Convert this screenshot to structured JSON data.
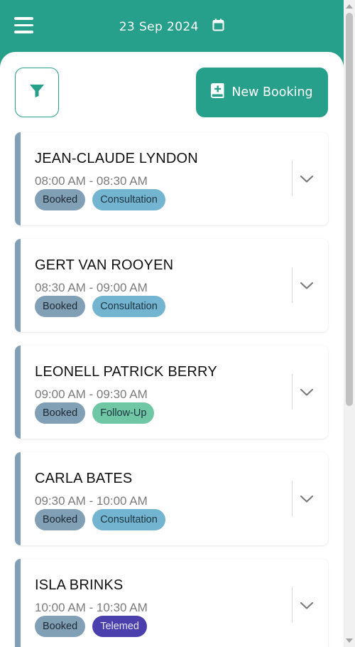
{
  "header": {
    "date": "23 Sep 2024",
    "menu_icon": "hamburger-menu-icon",
    "calendar_icon": "calendar-icon"
  },
  "toolbar": {
    "filter_icon": "filter-icon",
    "new_booking_label": "New Booking",
    "new_booking_icon": "add-book-icon"
  },
  "colors": {
    "brand": "#26a08a",
    "booked": "#819fb5",
    "consultation": "#73b5d0",
    "follow_up": "#6fc7a6",
    "telemed": "#4b3fae"
  },
  "bookings": [
    {
      "name": "JEAN-CLAUDE LYNDON",
      "time": "08:00 AM - 08:30 AM",
      "status": "Booked",
      "type": "Consultation",
      "type_key": "consultation"
    },
    {
      "name": "GERT VAN ROOYEN",
      "time": "08:30 AM - 09:00 AM",
      "status": "Booked",
      "type": "Consultation",
      "type_key": "consultation"
    },
    {
      "name": "LEONELL PATRICK BERRY",
      "time": "09:00 AM - 09:30 AM",
      "status": "Booked",
      "type": "Follow-Up",
      "type_key": "follow_up"
    },
    {
      "name": "CARLA BATES",
      "time": "09:30 AM - 10:00 AM",
      "status": "Booked",
      "type": "Consultation",
      "type_key": "consultation"
    },
    {
      "name": "ISLA BRINKS",
      "time": "10:00 AM - 10:30 AM",
      "status": "Booked",
      "type": "Telemed",
      "type_key": "telemed"
    }
  ]
}
